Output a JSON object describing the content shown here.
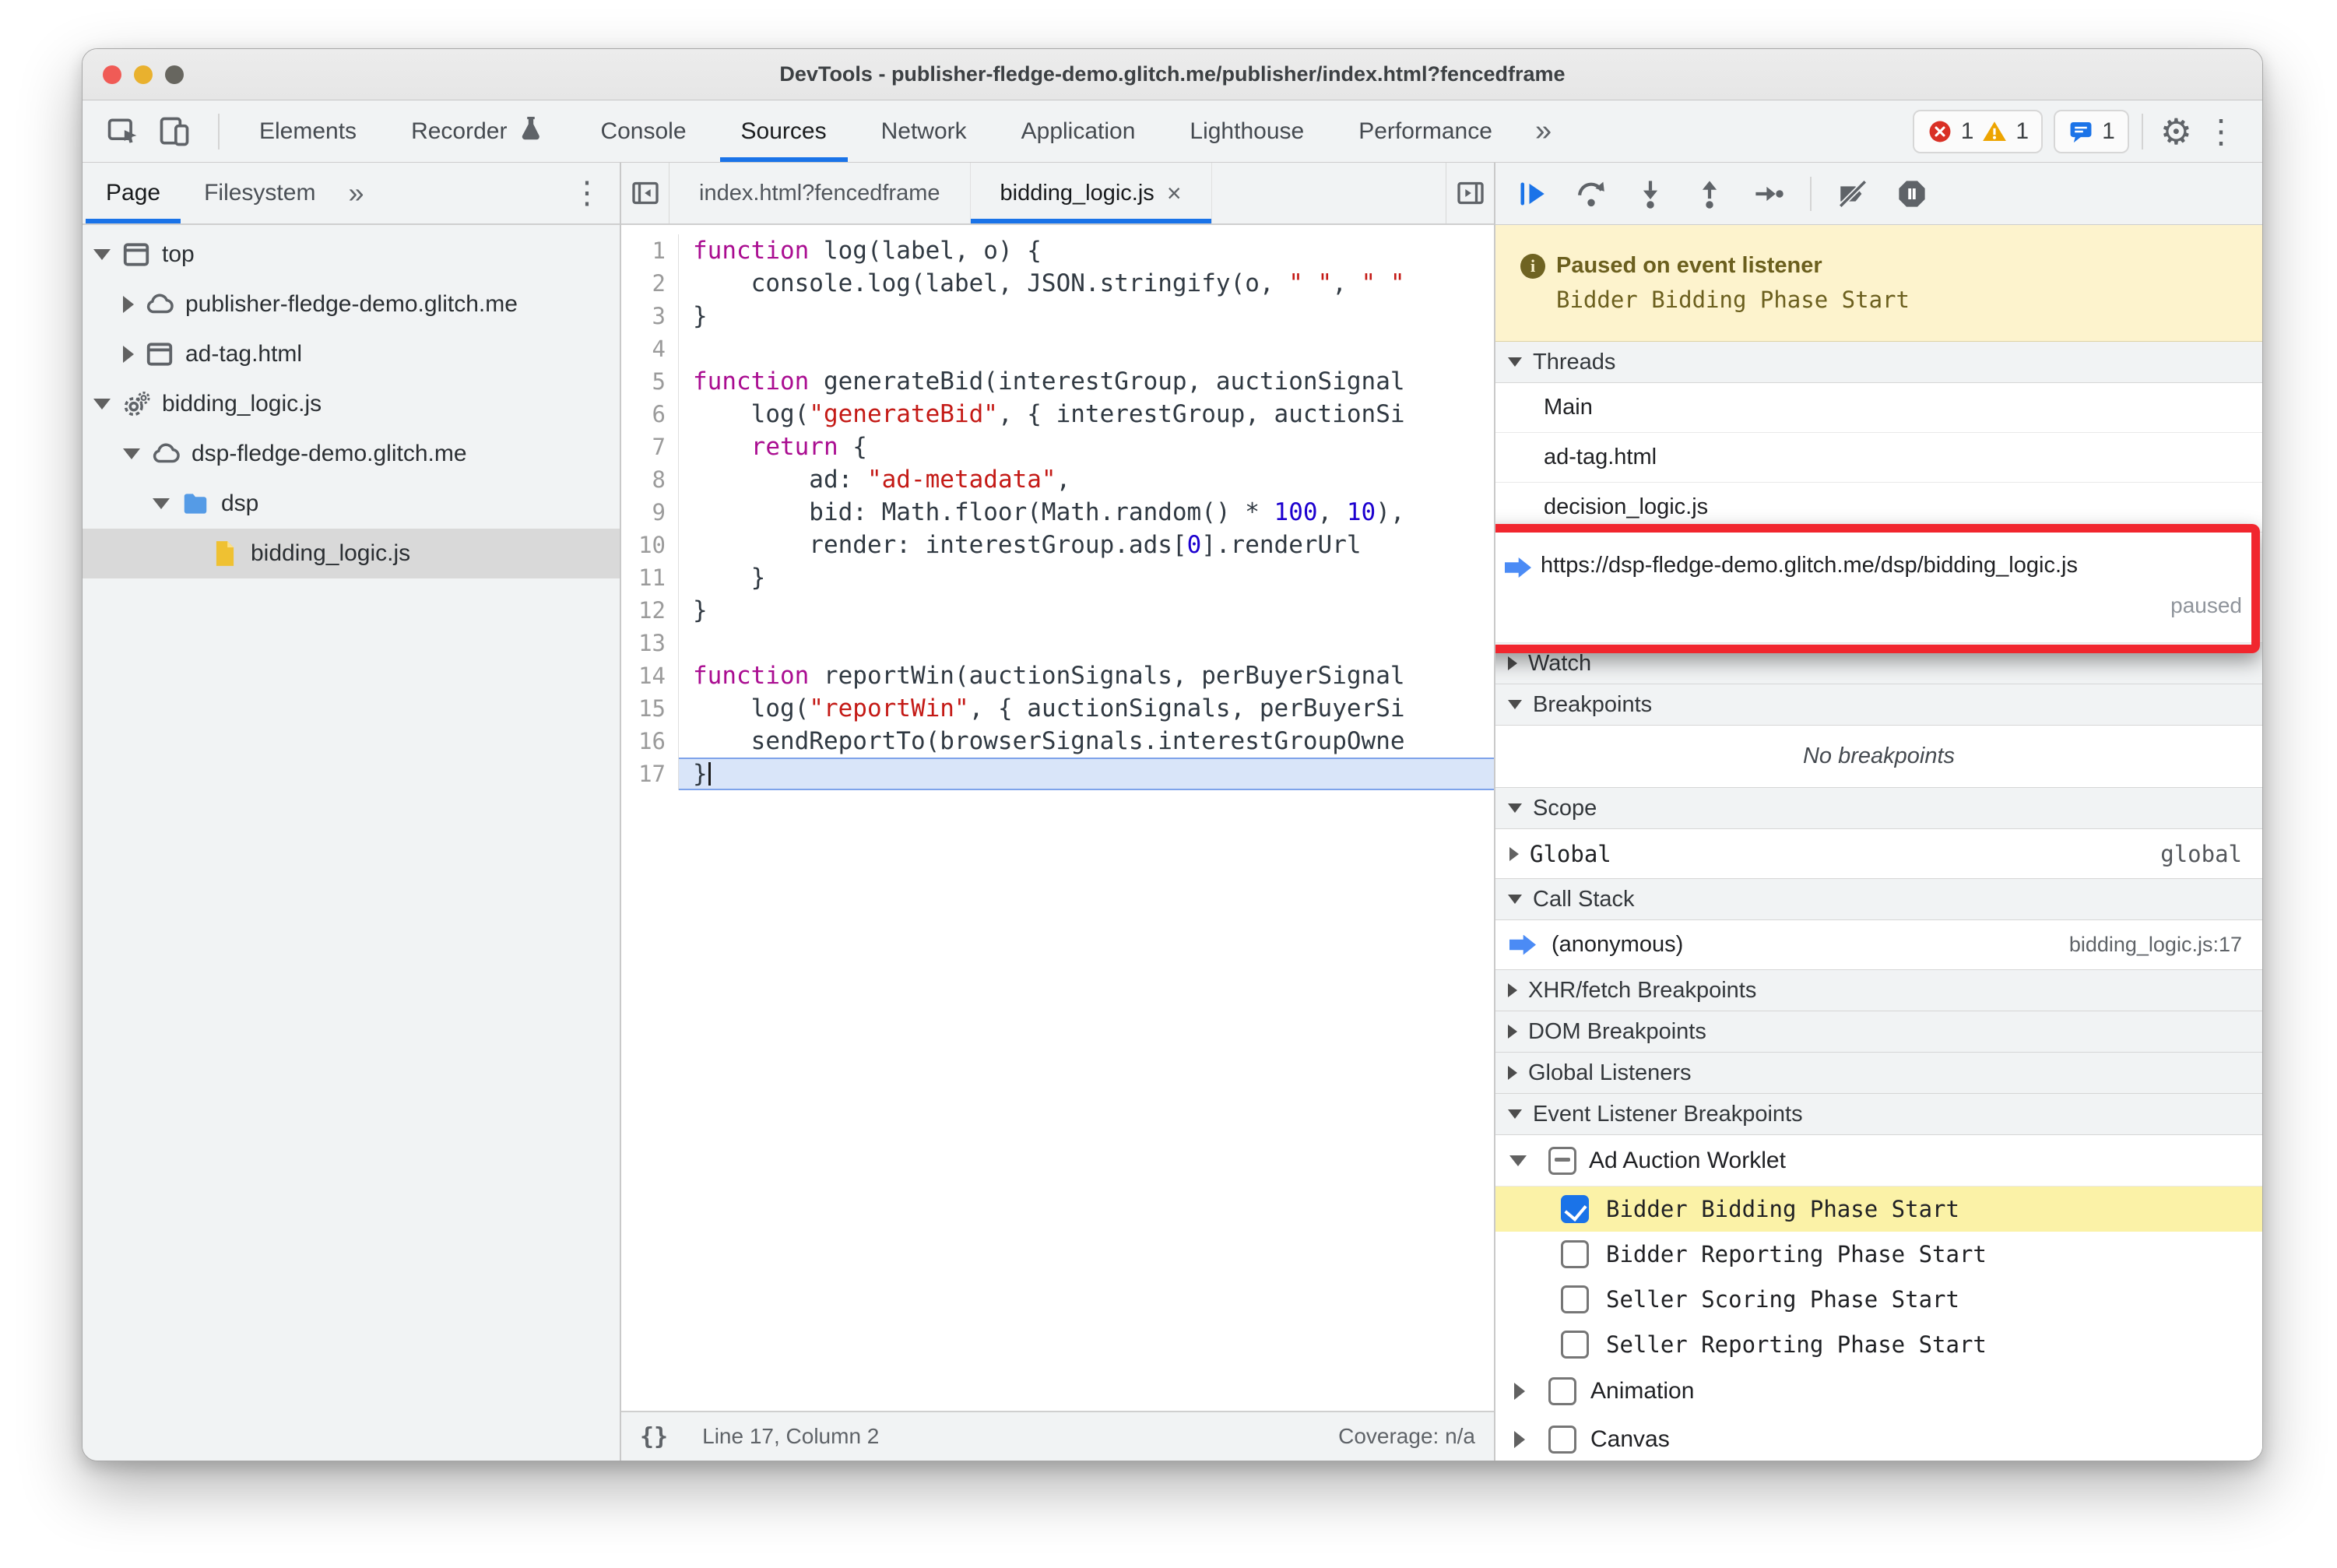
{
  "window": {
    "title": "DevTools - publisher-fledge-demo.glitch.me/publisher/index.html?fencedframe"
  },
  "toolbar": {
    "tabs": [
      {
        "label": "Elements"
      },
      {
        "label": "Recorder",
        "icon": "flask"
      },
      {
        "label": "Console"
      },
      {
        "label": "Sources"
      },
      {
        "label": "Network"
      },
      {
        "label": "Application"
      },
      {
        "label": "Lighthouse"
      },
      {
        "label": "Performance"
      }
    ],
    "active": "Sources",
    "more_glyph": "»",
    "badges": {
      "errors": "1",
      "warnings": "1",
      "messages": "1"
    },
    "gear_glyph": "⚙",
    "kebab_glyph": "⋮"
  },
  "navigator": {
    "tabs": [
      {
        "label": "Page"
      },
      {
        "label": "Filesystem"
      }
    ],
    "active": "Page",
    "more_glyph": "»",
    "menu_glyph": "⋮",
    "tree": [
      {
        "depth": 0,
        "disclosure": "open",
        "icon": "frame",
        "label": "top"
      },
      {
        "depth": 1,
        "disclosure": "closed",
        "icon": "cloud",
        "label": "publisher-fledge-demo.glitch.me"
      },
      {
        "depth": 1,
        "disclosure": "closed",
        "icon": "frame",
        "label": "ad-tag.html"
      },
      {
        "depth": 0,
        "disclosure": "open",
        "icon": "worker",
        "label": "bidding_logic.js"
      },
      {
        "depth": 1,
        "disclosure": "open",
        "icon": "cloud",
        "label": "dsp-fledge-demo.glitch.me"
      },
      {
        "depth": 2,
        "disclosure": "open",
        "icon": "folder",
        "label": "dsp"
      },
      {
        "depth": 3,
        "disclosure": "none",
        "icon": "file",
        "label": "bidding_logic.js",
        "selected": true
      }
    ]
  },
  "editor": {
    "tabs": [
      {
        "label": "index.html?fencedframe"
      },
      {
        "label": "bidding_logic.js",
        "active": true,
        "close_glyph": "×"
      }
    ],
    "code": {
      "lines": [
        {
          "n": 1,
          "seg": [
            [
              "k",
              "function"
            ],
            [
              "p",
              " log(label, o) {"
            ]
          ]
        },
        {
          "n": 2,
          "seg": [
            [
              "p",
              "    console.log(label, JSON.stringify(o, "
            ],
            [
              "s",
              "\" \""
            ],
            [
              "p",
              ", "
            ],
            [
              "s",
              "\" \""
            ]
          ]
        },
        {
          "n": 3,
          "seg": [
            [
              "p",
              "}"
            ]
          ]
        },
        {
          "n": 4,
          "seg": []
        },
        {
          "n": 5,
          "seg": [
            [
              "k",
              "function"
            ],
            [
              "p",
              " generateBid(interestGroup, auctionSignal"
            ]
          ]
        },
        {
          "n": 6,
          "seg": [
            [
              "p",
              "    log("
            ],
            [
              "s",
              "\"generateBid\""
            ],
            [
              "p",
              ", { interestGroup, auctionSi"
            ]
          ]
        },
        {
          "n": 7,
          "seg": [
            [
              "p",
              "    "
            ],
            [
              "k",
              "return"
            ],
            [
              "p",
              " {"
            ]
          ]
        },
        {
          "n": 8,
          "seg": [
            [
              "p",
              "        ad: "
            ],
            [
              "s",
              "\"ad-metadata\""
            ],
            [
              "p",
              ","
            ]
          ]
        },
        {
          "n": 9,
          "seg": [
            [
              "p",
              "        bid: Math.floor(Math.random() * "
            ],
            [
              "n2",
              "100"
            ],
            [
              "p",
              ", "
            ],
            [
              "n2",
              "10"
            ],
            [
              "p",
              "),"
            ]
          ]
        },
        {
          "n": 10,
          "seg": [
            [
              "p",
              "        render: interestGroup.ads["
            ],
            [
              "n2",
              "0"
            ],
            [
              "p",
              "].renderUrl"
            ]
          ]
        },
        {
          "n": 11,
          "seg": [
            [
              "p",
              "    }"
            ]
          ]
        },
        {
          "n": 12,
          "seg": [
            [
              "p",
              "}"
            ]
          ]
        },
        {
          "n": 13,
          "seg": []
        },
        {
          "n": 14,
          "seg": [
            [
              "k",
              "function"
            ],
            [
              "p",
              " reportWin(auctionSignals, perBuyerSignal"
            ]
          ]
        },
        {
          "n": 15,
          "seg": [
            [
              "p",
              "    log("
            ],
            [
              "s",
              "\"reportWin\""
            ],
            [
              "p",
              ", { auctionSignals, perBuyerSi"
            ]
          ]
        },
        {
          "n": 16,
          "seg": [
            [
              "p",
              "    sendReportTo(browserSignals.interestGroupOwne"
            ]
          ]
        },
        {
          "n": 17,
          "seg": [
            [
              "p",
              "}"
            ]
          ],
          "exec": true
        }
      ]
    },
    "status": {
      "pretty_print": "{}",
      "position": "Line 17, Column 2",
      "coverage": "Coverage: n/a"
    }
  },
  "debugger": {
    "toolbar": [
      "resume",
      "step-over",
      "step-into",
      "step-out",
      "step",
      "divider",
      "deactivate-breakpoints",
      "pause-on-exceptions"
    ],
    "paused": {
      "icon_glyph": "i",
      "title": "Paused on event listener",
      "detail": "Bidder Bidding Phase Start"
    },
    "sections": [
      {
        "type": "header",
        "label": "Threads",
        "state": "open"
      },
      {
        "type": "thread",
        "label": "Main"
      },
      {
        "type": "thread",
        "label": "ad-tag.html"
      },
      {
        "type": "thread",
        "label": "decision_logic.js"
      },
      {
        "type": "thread_paused",
        "label": "https://dsp-fledge-demo.glitch.me/dsp/bidding_logic.js",
        "status": "paused"
      },
      {
        "type": "header",
        "label": "Watch",
        "state": "closed"
      },
      {
        "type": "header",
        "label": "Breakpoints",
        "state": "open"
      },
      {
        "type": "empty",
        "label": "No breakpoints"
      },
      {
        "type": "header",
        "label": "Scope",
        "state": "open"
      },
      {
        "type": "scope_row",
        "label": "Global",
        "value": "global",
        "state": "closed"
      },
      {
        "type": "header",
        "label": "Call Stack",
        "state": "open"
      },
      {
        "type": "stack_row",
        "label": "(anonymous)",
        "value": "bidding_logic.js:17"
      },
      {
        "type": "header",
        "label": "XHR/fetch Breakpoints",
        "state": "closed"
      },
      {
        "type": "header",
        "label": "DOM Breakpoints",
        "state": "closed"
      },
      {
        "type": "header",
        "label": "Global Listeners",
        "state": "closed"
      },
      {
        "type": "header",
        "label": "Event Listener Breakpoints",
        "state": "open"
      },
      {
        "type": "group",
        "label": "Ad Auction Worklet",
        "state": "open",
        "checkbox": "indeterminate"
      },
      {
        "type": "check",
        "label": "Bidder Bidding Phase Start",
        "checkbox": "checked",
        "highlight": true
      },
      {
        "type": "check",
        "label": "Bidder Reporting Phase Start",
        "checkbox": "unchecked"
      },
      {
        "type": "check",
        "label": "Seller Scoring Phase Start",
        "checkbox": "unchecked"
      },
      {
        "type": "check",
        "label": "Seller Reporting Phase Start",
        "checkbox": "unchecked"
      },
      {
        "type": "group2",
        "label": "Animation",
        "state": "closed",
        "checkbox": "unchecked"
      },
      {
        "type": "group2",
        "label": "Canvas",
        "state": "closed",
        "checkbox": "unchecked"
      }
    ]
  },
  "colors": {
    "accent": "#1a73e8",
    "annotation_red": "#f1262e",
    "paused_banner_bg": "#fdf3cd",
    "paused_text": "#6b5f1e",
    "exec_line_bg": "#d9e5f9",
    "event_highlight_bg": "#fbf2a7",
    "keyword": "#aa0d91",
    "string": "#c41a16",
    "number": "#1c00cf",
    "selected_tree_row": "#d9d9d9"
  }
}
